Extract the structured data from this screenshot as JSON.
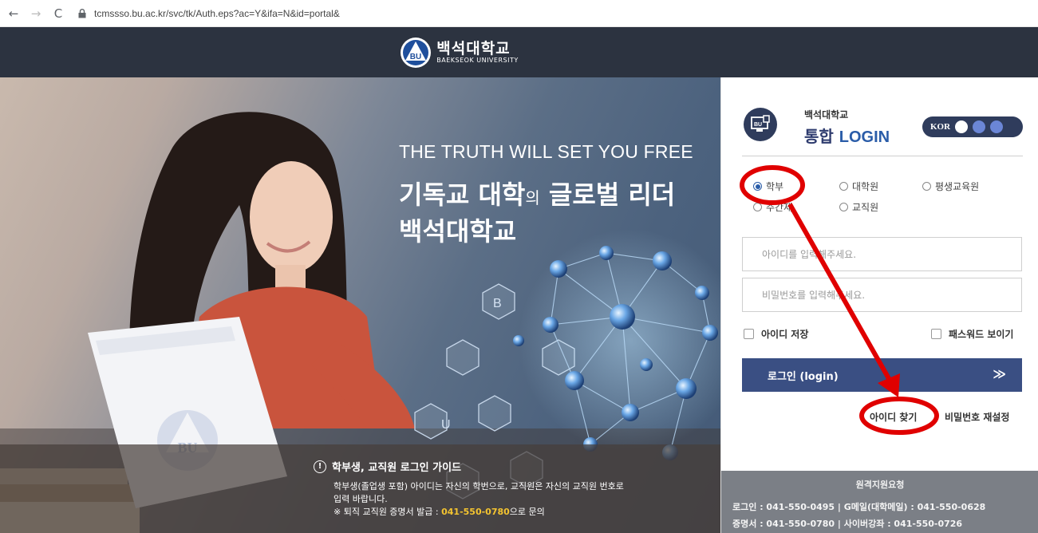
{
  "browser": {
    "back_icon": "←",
    "forward_icon": "→",
    "reload_icon": "C",
    "url": "tcmssso.bu.ac.kr/svc/tk/Auth.eps?ac=Y&ifa=N&id=portal&"
  },
  "header": {
    "logo_text": "백석대학교",
    "logo_sub": "BAEKSEOK UNIVERSITY",
    "emblem_text": "BU"
  },
  "hero": {
    "tagline": "THE TRUTH WILL SET YOU FREE",
    "headline_a": "기독교 대학",
    "headline_b": "의",
    "headline_c": " 글로벌 리더",
    "headline_2": "백석대학교",
    "paper_mark": "BU",
    "molecule_letters": [
      "B",
      "U"
    ]
  },
  "guide": {
    "title": "학부생, 교직원 로그인 가이드",
    "body_1": "학부생(졸업생 포함) 아이디는 자신의 학번으로, 교직원은 자신의 교직원 번호로",
    "body_2": "입력 바랍니다.",
    "body_3a": "※ 퇴직 교직원 증명서 발급 : ",
    "body_3b": "041-550-0780",
    "body_3c": "으로 문의"
  },
  "login": {
    "icon_text": "BU",
    "brand_small": "백석대학교",
    "brand_big_a": "통합 ",
    "brand_big_b": "LOGIN",
    "lang_label": "KOR",
    "radios": [
      {
        "label": "학부",
        "checked": true
      },
      {
        "label": "대학원",
        "checked": false
      },
      {
        "label": "평생교육원",
        "checked": false
      },
      {
        "label": "주간제",
        "checked": false
      },
      {
        "label": "교직원",
        "checked": false
      }
    ],
    "id_placeholder": "아이디를 입력해주세요.",
    "pw_placeholder": "비밀번호를 입력해주세요.",
    "save_id": "아이디 저장",
    "show_pw": "패스워드 보이기",
    "login_button": "로그인 (login)",
    "login_arrow": "≫",
    "find_id": "아이디 찾기",
    "reset_pw": "비밀번호 재설정"
  },
  "support": {
    "title": "원격지원요청",
    "line1": "로그인 : 041-550-0495  |  G메일(대학메일) : 041-550-0628",
    "line2": "증명서 : 041-550-0780  |  사이버강좌 : 041-550-0726"
  },
  "colors": {
    "header_bg": "#2c3340",
    "login_button": "#3a4f83",
    "annotation": "#e00000"
  }
}
